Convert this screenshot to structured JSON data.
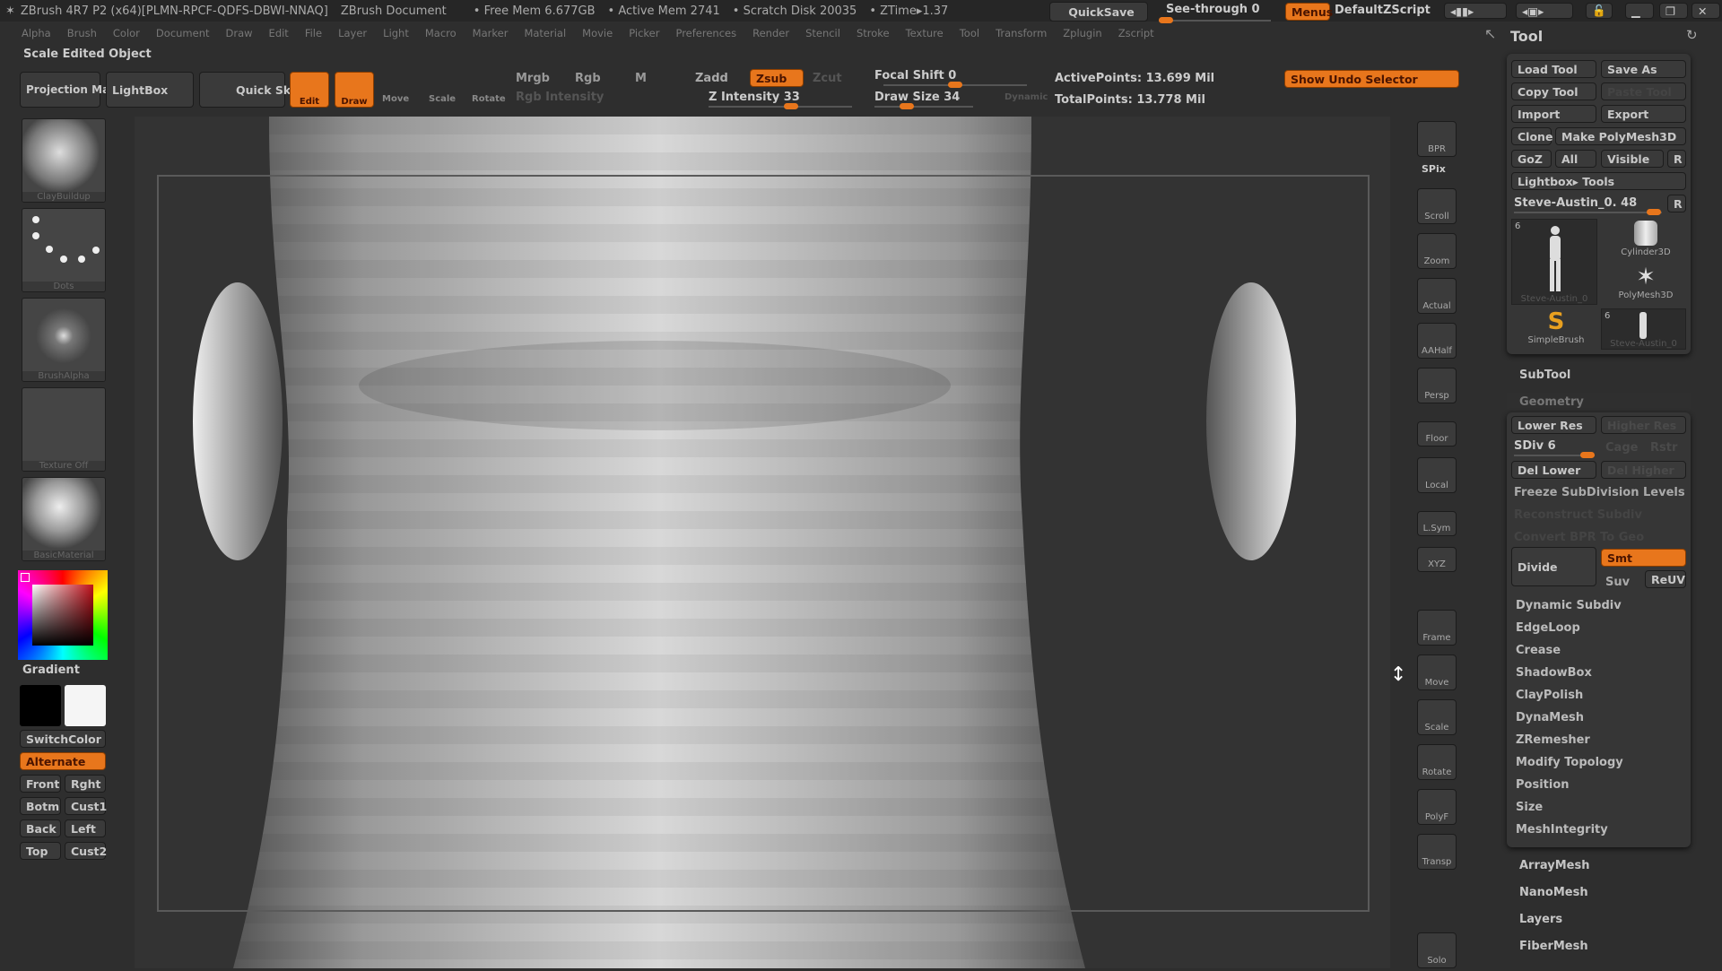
{
  "titlebar": {
    "app": "ZBrush 4R7 P2 (x64)[PLMN-RPCF-QDFS-DBWI-NNAQ]",
    "doc": "ZBrush Document",
    "free_mem": "• Free Mem 6.677GB",
    "active_mem": "• Active Mem 2741",
    "scratch": "• Scratch Disk 20035",
    "ztime": "• ZTime▸1.37",
    "quicksave": "QuickSave",
    "see_through": "See-through  0",
    "see_through_value": 0,
    "menus": "Menus",
    "script": "DefaultZScript"
  },
  "menu": [
    "Alpha",
    "Brush",
    "Color",
    "Document",
    "Draw",
    "Edit",
    "File",
    "Layer",
    "Light",
    "Macro",
    "Marker",
    "Material",
    "Movie",
    "Picker",
    "Preferences",
    "Render",
    "Stencil",
    "Stroke",
    "Texture",
    "Tool",
    "Transform",
    "Zplugin",
    "Zscript"
  ],
  "status": "Scale Edited Object",
  "toolbar": {
    "projection_master": "Projection Master",
    "lightbox": "LightBox",
    "quick_sketch": "Quick Sketch",
    "edit": "Edit",
    "draw": "Draw",
    "move": "Move",
    "scale": "Scale",
    "rotate": "Rotate",
    "mrgb": "Mrgb",
    "rgb": "Rgb",
    "m": "M",
    "rgb_intensity": "Rgb Intensity",
    "zadd": "Zadd",
    "zsub": "Zsub",
    "zcut": "Zcut",
    "z_intensity": "Z Intensity 33",
    "z_intensity_value": 33,
    "focal_shift": "Focal Shift 0",
    "focal_shift_value": 0,
    "draw_size": "Draw Size 34",
    "draw_size_value": 34,
    "dynamic": "Dynamic",
    "active_points": "ActivePoints: 13.699 Mil",
    "total_points": "TotalPoints: 13.778 Mil",
    "show_undo": "Show Undo Selector"
  },
  "left": {
    "brush": "ClayBuildup",
    "stroke": "Dots",
    "alpha": "BrushAlpha",
    "texture": "Texture Off",
    "material": "BasicMaterial",
    "gradient": "Gradient",
    "switch_color": "SwitchColor",
    "alternate": "Alternate",
    "views": [
      "Front",
      "Rght",
      "Botm",
      "Cust1",
      "Back",
      "Left",
      "Top",
      "Cust2"
    ],
    "primary_color": "#c0101a"
  },
  "rightshelf": [
    "BPR",
    "SPix",
    "Scroll",
    "Zoom",
    "Actual",
    "AAHalf",
    "Persp",
    "Floor",
    "Local",
    "L.Sym",
    "XYZ",
    "Frame",
    "Move",
    "Scale",
    "Rotate",
    "PolyF",
    "Transp",
    "Solo"
  ],
  "tool": {
    "title": "Tool",
    "load": "Load Tool",
    "save_as": "Save As",
    "copy": "Copy Tool",
    "paste": "Paste Tool",
    "import": "Import",
    "export": "Export",
    "clone": "Clone",
    "make_polymesh": "Make PolyMesh3D",
    "goz": "GoZ",
    "all": "All",
    "visible": "Visible",
    "r": "R",
    "lightbox_tools": "Lightbox▸ Tools",
    "current": "Steve-Austin_0. 48",
    "current_value": 48,
    "tools": [
      {
        "name": "Steve-Austin_0",
        "count": "6"
      },
      {
        "name": "Cylinder3D"
      },
      {
        "name": "PolyMesh3D"
      },
      {
        "name": "SimpleBrush"
      },
      {
        "name": "Steve-Austin_0",
        "count": "6"
      }
    ],
    "subtool": "SubTool",
    "geometry": "Geometry",
    "lower_res": "Lower Res",
    "higher_res": "Higher Res",
    "sdiv": "SDiv 6",
    "sdiv_value": 6,
    "cage": "Cage",
    "rstr": "Rstr",
    "del_lower": "Del Lower",
    "del_higher": "Del Higher",
    "freeze": "Freeze SubDivision Levels",
    "reconstruct": "Reconstruct Subdiv",
    "convert": "Convert BPR To Geo",
    "divide": "Divide",
    "smt": "Smt",
    "suv": "Suv",
    "reuv": "ReUV",
    "items": [
      "Dynamic Subdiv",
      "EdgeLoop",
      "Crease",
      "ShadowBox",
      "ClayPolish",
      "DynaMesh",
      "ZRemesher",
      "Modify Topology",
      "Position",
      "Size",
      "MeshIntegrity"
    ],
    "sections": [
      "ArrayMesh",
      "NanoMesh",
      "Layers",
      "FiberMesh"
    ]
  }
}
